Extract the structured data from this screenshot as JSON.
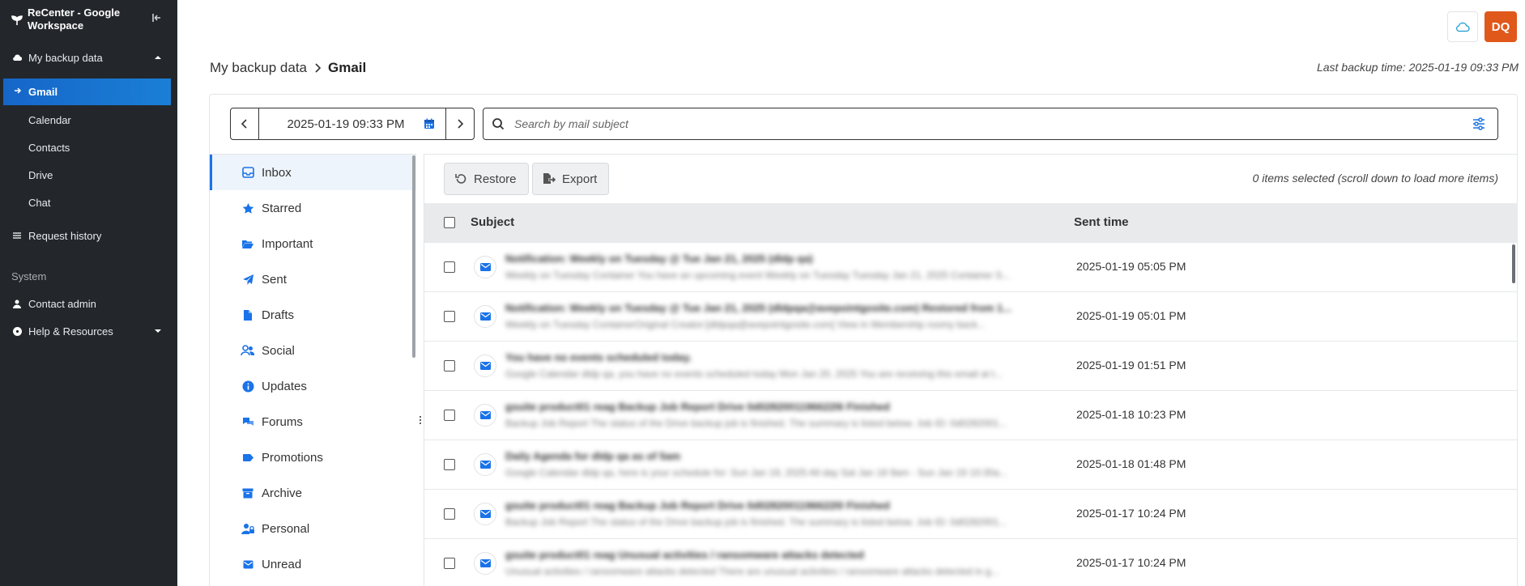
{
  "sidebar": {
    "brand": "ReCenter - Google Workspace",
    "my_backup_data": "My backup data",
    "sub_items": [
      "Gmail",
      "Calendar",
      "Contacts",
      "Drive",
      "Chat"
    ],
    "request_history": "Request history",
    "system_label": "System",
    "contact_admin": "Contact admin",
    "help_resources": "Help & Resources"
  },
  "header": {
    "avatar_initials": "DQ",
    "breadcrumb_root": "My backup data",
    "breadcrumb_current": "Gmail",
    "last_backup": "Last backup time: 2025-01-19 09:33 PM"
  },
  "date_picker": {
    "value": "2025-01-19 09:33 PM"
  },
  "search": {
    "placeholder": "Search by mail subject"
  },
  "folders": [
    "Inbox",
    "Starred",
    "Important",
    "Sent",
    "Drafts",
    "Social",
    "Updates",
    "Forums",
    "Promotions",
    "Archive",
    "Personal",
    "Unread"
  ],
  "toolbar": {
    "restore": "Restore",
    "export": "Export",
    "selected_info": "0 items selected (scroll down to load more items)"
  },
  "table": {
    "col_subject": "Subject",
    "col_sent": "Sent time",
    "rows": [
      {
        "subject": "Notification: Weekly on Tuesday @ Tue Jan 21, 2025 (dldp qa)",
        "preview": "Weekly on Tuesday Container You have an upcoming event Weekly on Tuesday Tuesday Jan 21, 2025 Container S...",
        "sent": "2025-01-19 05:05 PM"
      },
      {
        "subject": "Notification: Weekly on Tuesday @ Tue Jan 21, 2025 (dldpqa@avepointgosite.com) Restored from 1...",
        "preview": "Weekly on Tuesday ContainerOriginal Creator:[dldpqa@avepointgosite.com] View in Membership roomy back...",
        "sent": "2025-01-19 05:01 PM"
      },
      {
        "subject": "You have no events scheduled today.",
        "preview": "Google Calendar dldp qa, you have no events scheduled today Mon Jan 20, 2025 You are receiving this email at t...",
        "sent": "2025-01-19 01:51 PM"
      },
      {
        "subject": "gsuite product01 reag Backup Job Report Drive 0d0282001196622l6 Finished",
        "preview": "Backup Job Report The status of the Drive backup job is finished. The summary is listed below. Job ID: 0d0282001...",
        "sent": "2025-01-18 10:23 PM"
      },
      {
        "subject": "Daily Agenda for dldp qa as of 5am",
        "preview": "Google Calendar dldp qa, here is your schedule for: Sun Jan 19, 2025 All day Sat Jan 18 9am - Sun Jan 19 10:30a...",
        "sent": "2025-01-18 01:48 PM"
      },
      {
        "subject": "gsuite product01 reag Backup Job Report Drive 0d0282001196622l0 Finished",
        "preview": "Backup Job Report The status of the Drive backup job is finished. The summary is listed below. Job ID: 0d0282001...",
        "sent": "2025-01-17 10:24 PM"
      },
      {
        "subject": "gsuite product01 reag Unusual activities / ransomware attacks detected",
        "preview": "Unusual activities / ransomware attacks detected There are unusual activities / ransomware attacks detected in g...",
        "sent": "2025-01-17 10:24 PM"
      }
    ]
  }
}
